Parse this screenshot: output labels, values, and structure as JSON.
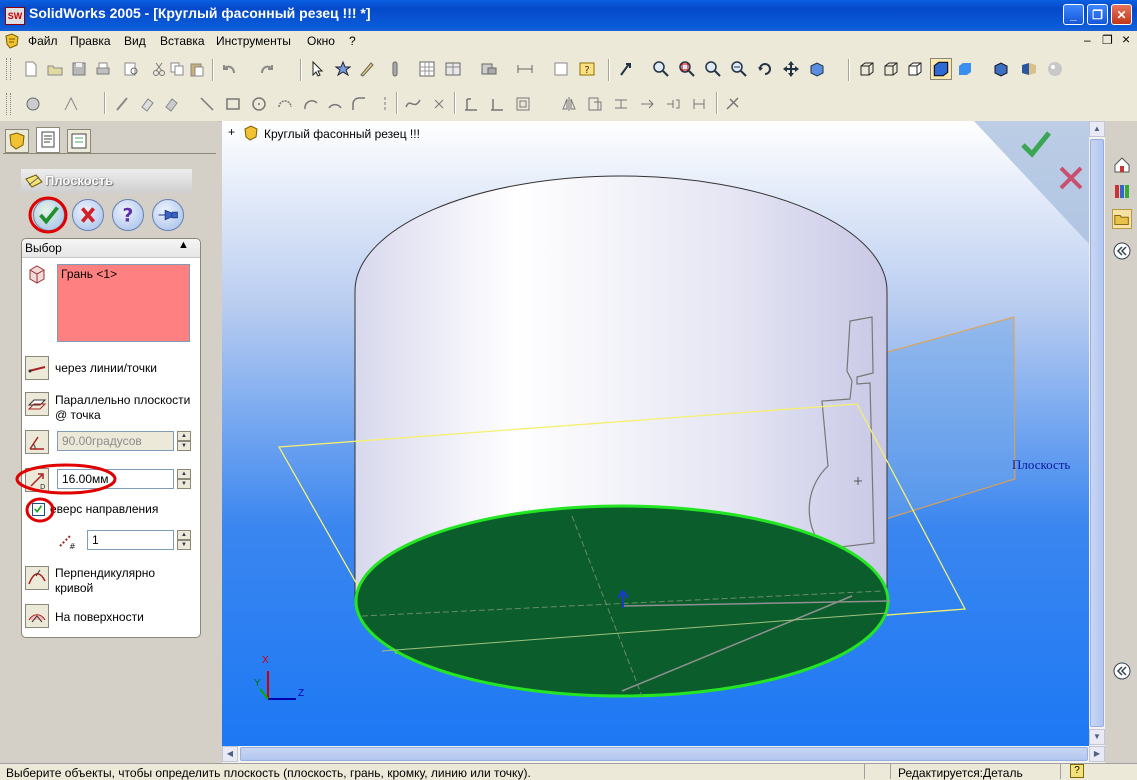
{
  "window": {
    "app_icon_label": "SW",
    "title": "SolidWorks 2005 - [Круглый фасонный резец !!! *]",
    "controls": {
      "minimize": "_",
      "maximize": "❐",
      "close": "✕"
    }
  },
  "menu": {
    "items": [
      "Файл",
      "Правка",
      "Вид",
      "Вставка",
      "Инструменты",
      "Окно",
      "?"
    ],
    "doc_controls": {
      "minimize": "–",
      "restore": "❐",
      "close": "×"
    }
  },
  "feature_tree": {
    "expand": "+",
    "root_label": "Круглый фасонный резец !!!"
  },
  "property_manager": {
    "title": "Плоскость",
    "section_title": "Выбор",
    "selection_item": "Грань <1>",
    "options": {
      "through_lines": "через линии/точки",
      "parallel_plane_line1": "Параллельно плоскости",
      "parallel_plane_line2": "@ точка",
      "perpendicular_line1": "Перпендикулярно",
      "perpendicular_line2": "кривой",
      "on_surface": "На поверхности"
    },
    "angle_value": "90.00градусов",
    "distance_value": "16.00мм",
    "reverse_label": "еверс направления",
    "reverse_checked": true,
    "count_value": "1"
  },
  "viewport": {
    "plane_label": "Плоскость",
    "axes": {
      "x": "X",
      "y": "Y",
      "z": "Z"
    },
    "colors": {
      "face_fill": "#0b5e2c",
      "face_edge": "#23e523",
      "plane_preview": "#f5f070",
      "ok": "#3aa553",
      "cancel": "#c8506e"
    }
  },
  "status": {
    "message": "Выберите объекты, чтобы определить плоскость (плоскость, грань, кромку, линию или точку).",
    "state": "Редактируется:Деталь",
    "help": "?"
  }
}
